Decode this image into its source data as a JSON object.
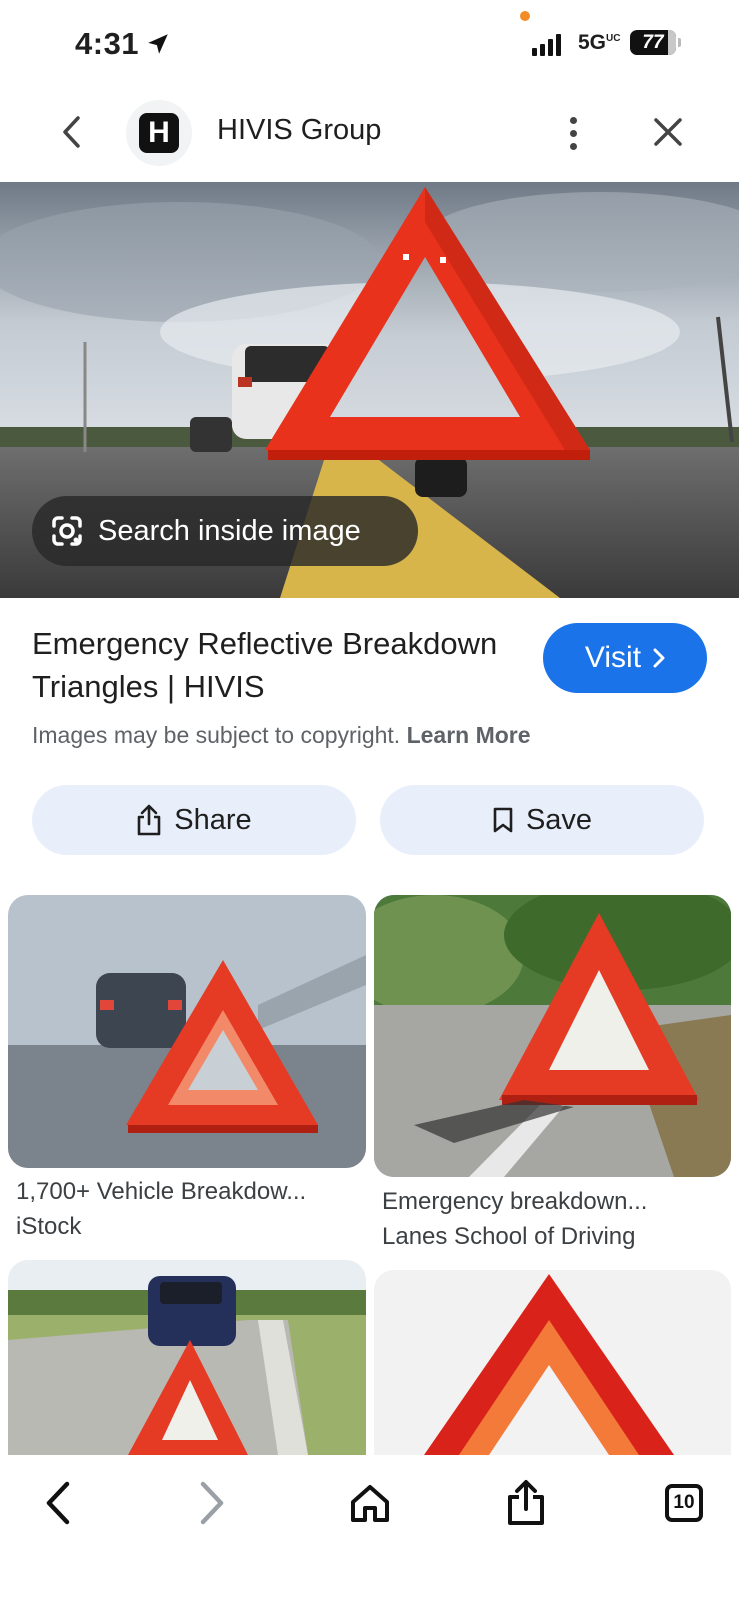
{
  "status_bar": {
    "time": "4:31",
    "network": "5G",
    "network_suffix": "UC",
    "battery": "77"
  },
  "header": {
    "site_logo_letter": "H",
    "site_name": "HIVIS Group"
  },
  "hero": {
    "lens_label": "Search inside image"
  },
  "result": {
    "title": "Emergency Reflective Breakdown Triangles | HIVIS",
    "visit_label": "Visit",
    "copyright_text": "Images may be subject to copyright.",
    "learn_more": "Learn More"
  },
  "actions": {
    "share_label": "Share",
    "save_label": "Save"
  },
  "related": [
    {
      "title": "1,700+ Vehicle Breakdow...",
      "source": "iStock"
    },
    {
      "title": "Emergency breakdown...",
      "source": "Lanes School of Driving"
    },
    {
      "title": "",
      "source": ""
    },
    {
      "title": "",
      "source": ""
    }
  ],
  "bottom_nav": {
    "tabs_count": "10"
  },
  "colors": {
    "accent": "#1a73e8",
    "pill_bg": "#e8effb",
    "triangle_red": "#e8321c"
  }
}
